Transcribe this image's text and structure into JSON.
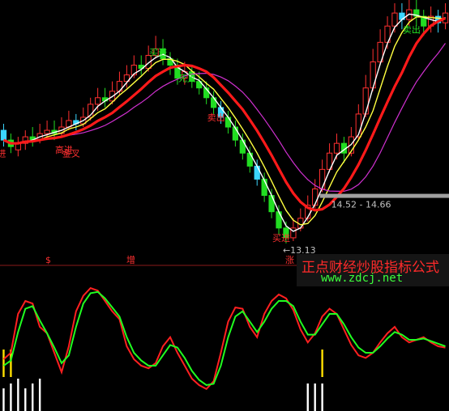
{
  "chart_data": [
    {
      "type": "candlestick",
      "price_range_label": "14.52 - 14.66",
      "low_label": "13.13",
      "signals": [
        "进",
        "高进",
        "金叉",
        "买进",
        "死叉",
        "卖出",
        "买进",
        "卖出"
      ],
      "candles": [
        [
          16.6,
          16.3,
          16.8,
          16.1
        ],
        [
          16.3,
          16.1,
          16.5,
          15.9
        ],
        [
          16.0,
          16.2,
          16.4,
          15.8
        ],
        [
          16.2,
          16.4,
          16.6,
          16.0
        ],
        [
          16.4,
          16.3,
          16.7,
          16.1
        ],
        [
          16.3,
          16.5,
          16.8,
          16.2
        ],
        [
          16.5,
          16.6,
          16.9,
          16.3
        ],
        [
          16.6,
          16.5,
          16.9,
          16.3
        ],
        [
          16.5,
          16.7,
          17.0,
          16.4
        ],
        [
          16.7,
          16.9,
          17.2,
          16.6
        ],
        [
          16.9,
          16.8,
          17.1,
          16.6
        ],
        [
          16.8,
          17.0,
          17.3,
          16.7
        ],
        [
          17.0,
          17.4,
          17.6,
          16.9
        ],
        [
          17.4,
          17.6,
          17.9,
          17.2
        ],
        [
          17.6,
          17.5,
          17.9,
          17.3
        ],
        [
          17.5,
          17.8,
          18.1,
          17.4
        ],
        [
          17.8,
          18.1,
          18.4,
          17.7
        ],
        [
          18.1,
          18.3,
          18.6,
          17.9
        ],
        [
          18.3,
          18.6,
          18.9,
          18.2
        ],
        [
          18.6,
          18.5,
          18.9,
          18.3
        ],
        [
          18.5,
          18.9,
          19.2,
          18.4
        ],
        [
          18.9,
          19.1,
          19.5,
          18.8
        ],
        [
          19.1,
          18.8,
          19.4,
          18.6
        ],
        [
          18.8,
          18.6,
          19.0,
          18.3
        ],
        [
          18.6,
          18.2,
          18.8,
          18.0
        ],
        [
          18.2,
          18.4,
          18.7,
          18.0
        ],
        [
          18.4,
          18.1,
          18.6,
          17.9
        ],
        [
          18.1,
          17.9,
          18.4,
          17.7
        ],
        [
          17.9,
          17.6,
          18.1,
          17.4
        ],
        [
          17.6,
          17.3,
          17.8,
          17.1
        ],
        [
          17.3,
          17.0,
          17.5,
          16.8
        ],
        [
          17.0,
          16.7,
          17.2,
          16.5
        ],
        [
          16.7,
          16.3,
          16.9,
          16.1
        ],
        [
          16.3,
          15.9,
          16.5,
          15.7
        ],
        [
          15.9,
          15.5,
          16.1,
          15.3
        ],
        [
          15.5,
          15.1,
          15.7,
          14.9
        ],
        [
          15.1,
          14.6,
          15.3,
          14.4
        ],
        [
          14.6,
          14.1,
          14.8,
          13.9
        ],
        [
          14.1,
          13.6,
          14.3,
          13.4
        ],
        [
          13.6,
          13.3,
          13.8,
          13.13
        ],
        [
          13.3,
          13.6,
          13.9,
          13.2
        ],
        [
          13.6,
          13.9,
          14.2,
          13.5
        ],
        [
          13.9,
          14.3,
          14.6,
          13.8
        ],
        [
          14.3,
          14.8,
          15.1,
          14.2
        ],
        [
          14.8,
          15.4,
          15.7,
          14.7
        ],
        [
          15.4,
          15.9,
          16.2,
          15.3
        ],
        [
          15.9,
          16.2,
          16.5,
          15.7
        ],
        [
          16.2,
          15.9,
          16.4,
          15.6
        ],
        [
          15.9,
          16.4,
          16.7,
          15.8
        ],
        [
          16.4,
          17.1,
          17.4,
          16.3
        ],
        [
          17.1,
          17.9,
          18.3,
          17.0
        ],
        [
          17.9,
          18.7,
          19.1,
          17.8
        ],
        [
          18.7,
          19.3,
          19.7,
          18.6
        ],
        [
          19.3,
          19.8,
          20.1,
          19.1
        ],
        [
          19.8,
          20.2,
          20.5,
          19.6
        ],
        [
          20.2,
          20.0,
          20.5,
          19.7
        ],
        [
          20.0,
          20.3,
          20.6,
          19.8
        ],
        [
          20.3,
          20.1,
          20.6,
          19.8
        ],
        [
          20.1,
          19.8,
          20.3,
          19.5
        ],
        [
          19.8,
          20.1,
          20.4,
          19.6
        ],
        [
          20.1,
          19.9,
          20.3,
          19.6
        ],
        [
          19.9,
          20.2,
          20.5,
          19.7
        ]
      ],
      "ylim": [
        13.0,
        20.6
      ]
    },
    {
      "type": "line",
      "scale_labels": [
        "$",
        "增",
        "涨"
      ],
      "series": [
        {
          "color": "#ff2020",
          "values": [
            35,
            40,
            70,
            80,
            78,
            60,
            55,
            40,
            25,
            45,
            72,
            84,
            90,
            88,
            80,
            72,
            66,
            45,
            35,
            30,
            28,
            32,
            45,
            52,
            40,
            30,
            20,
            15,
            12,
            18,
            40,
            64,
            75,
            74,
            60,
            52,
            70,
            80,
            85,
            82,
            73,
            58,
            48,
            55,
            68,
            74,
            70,
            58,
            46,
            38,
            36,
            40,
            48,
            55,
            60,
            52,
            48,
            50,
            52,
            48,
            45,
            44
          ]
        },
        {
          "color": "#20ff20",
          "values": [
            30,
            34,
            56,
            74,
            76,
            65,
            55,
            44,
            32,
            38,
            60,
            78,
            86,
            87,
            82,
            75,
            68,
            52,
            40,
            34,
            30,
            30,
            38,
            46,
            44,
            36,
            26,
            19,
            15,
            16,
            30,
            52,
            68,
            72,
            64,
            56,
            64,
            74,
            80,
            80,
            76,
            64,
            54,
            54,
            62,
            70,
            70,
            62,
            52,
            44,
            40,
            40,
            45,
            51,
            56,
            54,
            50,
            50,
            51,
            49,
            47,
            45
          ]
        }
      ],
      "ylim": [
        0,
        100
      ]
    }
  ],
  "brand": {
    "title": "正点财经炒股指标公式",
    "url": "www.zdcj.net"
  }
}
